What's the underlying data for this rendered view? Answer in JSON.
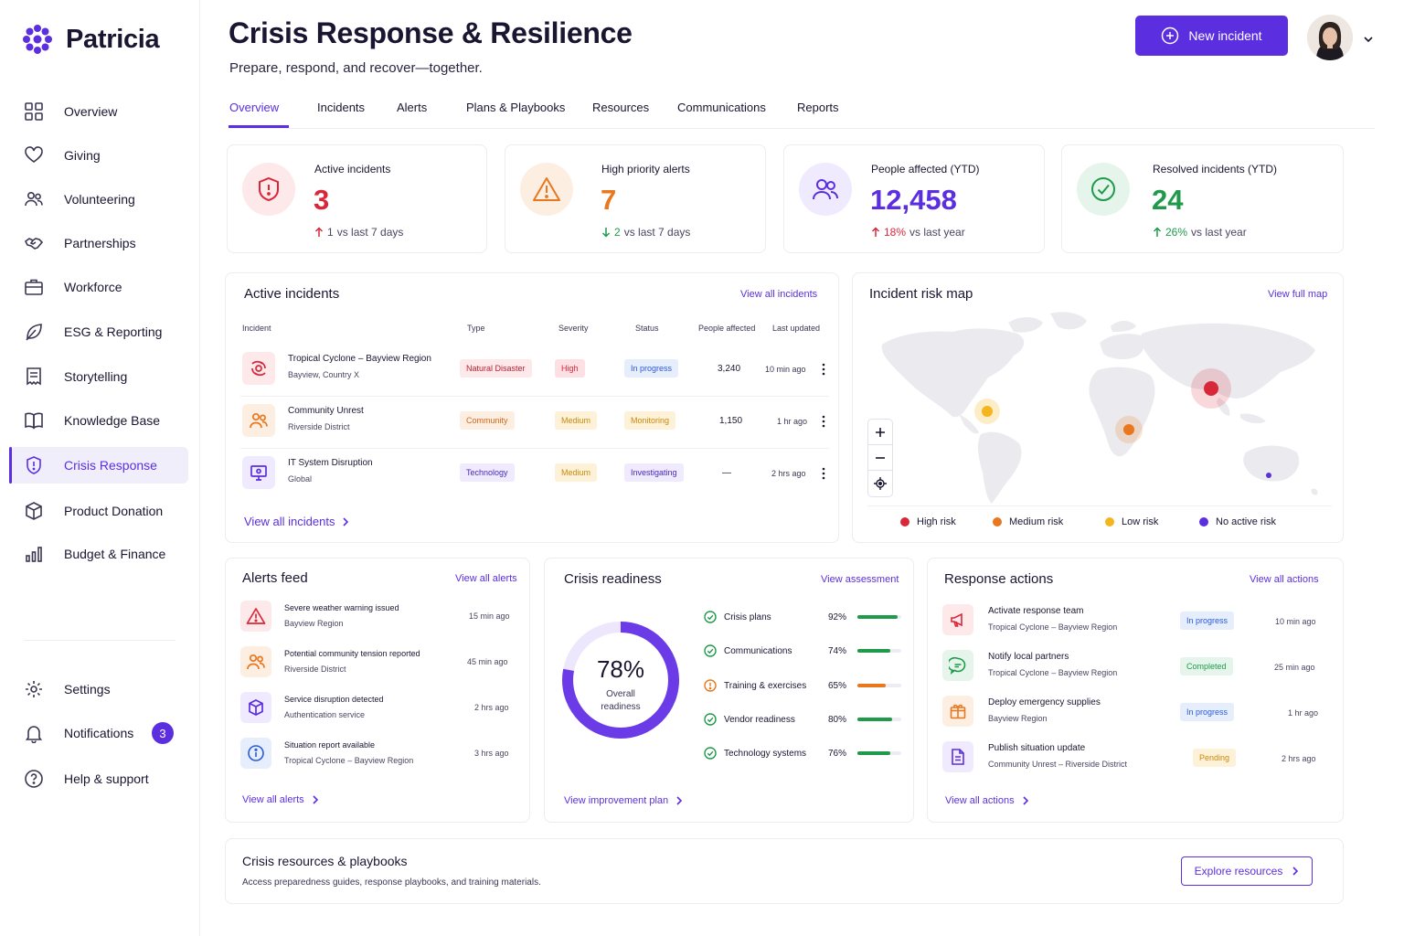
{
  "brand": {
    "name": "Patricia"
  },
  "sidebar": {
    "items": [
      {
        "label": "Overview"
      },
      {
        "label": "Giving"
      },
      {
        "label": "Volunteering"
      },
      {
        "label": "Partnerships"
      },
      {
        "label": "Workforce"
      },
      {
        "label": "ESG & Reporting"
      },
      {
        "label": "Storytelling"
      },
      {
        "label": "Knowledge Base"
      },
      {
        "label": "Crisis Response"
      },
      {
        "label": "Product Donation"
      },
      {
        "label": "Budget & Finance"
      }
    ],
    "bottom": [
      {
        "label": "Settings"
      },
      {
        "label": "Notifications",
        "badge": "3"
      },
      {
        "label": "Help & support"
      }
    ]
  },
  "header": {
    "title": "Crisis Response & Resilience",
    "subtitle": "Prepare, respond, and recover—together.",
    "new_incident": "New incident"
  },
  "tabs": [
    "Overview",
    "Incidents",
    "Alerts",
    "Plans & Playbooks",
    "Resources",
    "Communications",
    "Reports"
  ],
  "stats": [
    {
      "label": "Active incidents",
      "value": "3",
      "delta": "1",
      "delta_text": "vs last 7 days",
      "color": "#d9273a"
    },
    {
      "label": "High priority alerts",
      "value": "7",
      "delta": "2",
      "delta_text": "vs last 7 days",
      "color": "#e8771e"
    },
    {
      "label": "People affected (YTD)",
      "value": "12,458",
      "delta": "18%",
      "delta_text": "vs last year",
      "color": "#5b2ee0"
    },
    {
      "label": "Resolved incidents (YTD)",
      "value": "24",
      "delta": "26%",
      "delta_text": "vs last year",
      "color": "#1f9a4a"
    }
  ],
  "incidents": {
    "title": "Active incidents",
    "view_all_top": "View all incidents",
    "view_all_bottom": "View all incidents",
    "columns": [
      "Incident",
      "Type",
      "Severity",
      "Status",
      "People affected",
      "Last updated"
    ],
    "rows": [
      {
        "name": "Tropical Cyclone – Bayview Region",
        "location": "Bayview, Country X",
        "type": "Natural Disaster",
        "severity": "High",
        "status": "In progress",
        "people": "3,240",
        "updated": "10 min ago"
      },
      {
        "name": "Community Unrest",
        "location": "Riverside District",
        "type": "Community",
        "severity": "Medium",
        "status": "Monitoring",
        "people": "1,150",
        "updated": "1 hr ago"
      },
      {
        "name": "IT System Disruption",
        "location": "Global",
        "type": "Technology",
        "severity": "Medium",
        "status": "Investigating",
        "people": "—",
        "updated": "2 hrs ago"
      }
    ]
  },
  "map": {
    "title": "Incident risk map",
    "view_full": "View full map",
    "legend": [
      {
        "label": "High risk",
        "color": "#d9273a"
      },
      {
        "label": "Medium risk",
        "color": "#e8771e"
      },
      {
        "label": "Low risk",
        "color": "#f3b61f"
      },
      {
        "label": "No active risk",
        "color": "#5b2ee0"
      }
    ]
  },
  "alerts": {
    "title": "Alerts feed",
    "view_all_top": "View all alerts",
    "view_all_bottom": "View all alerts",
    "items": [
      {
        "title": "Severe weather warning issued",
        "sub": "Bayview Region",
        "time": "15 min ago"
      },
      {
        "title": "Potential community tension reported",
        "sub": "Riverside District",
        "time": "45 min ago"
      },
      {
        "title": "Service disruption detected",
        "sub": "Authentication service",
        "time": "2 hrs ago"
      },
      {
        "title": "Situation report available",
        "sub": "Tropical Cyclone – Bayview Region",
        "time": "3 hrs ago"
      }
    ]
  },
  "readiness": {
    "title": "Crisis readiness",
    "view_assessment": "View assessment",
    "overall_value": "78%",
    "overall_fraction": 0.78,
    "overall_label": "Overall readiness",
    "items": [
      {
        "label": "Crisis plans",
        "pct": "92%",
        "fraction": 0.92,
        "color": "#1f9a4a"
      },
      {
        "label": "Communications",
        "pct": "74%",
        "fraction": 0.74,
        "color": "#1f9a4a"
      },
      {
        "label": "Training & exercises",
        "pct": "65%",
        "fraction": 0.65,
        "color": "#e8771e"
      },
      {
        "label": "Vendor readiness",
        "pct": "80%",
        "fraction": 0.8,
        "color": "#1f9a4a"
      },
      {
        "label": "Technology systems",
        "pct": "76%",
        "fraction": 0.76,
        "color": "#1f9a4a"
      }
    ],
    "view_plan": "View improvement plan"
  },
  "actions": {
    "title": "Response actions",
    "view_all_top": "View all actions",
    "view_all_bottom": "View all actions",
    "items": [
      {
        "title": "Activate response team",
        "sub": "Tropical Cyclone – Bayview Region",
        "status": "In progress",
        "time": "10 min ago"
      },
      {
        "title": "Notify local partners",
        "sub": "Tropical Cyclone – Bayview Region",
        "status": "Completed",
        "time": "25 min ago"
      },
      {
        "title": "Deploy emergency supplies",
        "sub": "Bayview Region",
        "status": "In progress",
        "time": "1 hr ago"
      },
      {
        "title": "Publish situation update",
        "sub": "Community Unrest – Riverside District",
        "status": "Pending",
        "time": "2 hrs ago"
      }
    ]
  },
  "resources": {
    "title": "Crisis resources & playbooks",
    "description": "Access preparedness guides, response playbooks, and training materials.",
    "button": "Explore resources"
  }
}
